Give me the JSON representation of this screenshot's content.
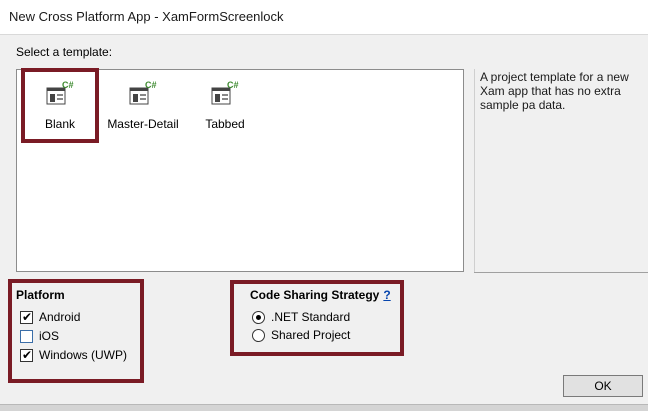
{
  "window": {
    "title": "New Cross Platform App - XamFormScreenlock"
  },
  "templates": {
    "heading": "Select a template:",
    "items": [
      {
        "label": "Blank",
        "badge": "C#",
        "selected": true
      },
      {
        "label": "Master-Detail",
        "badge": "C#",
        "selected": false
      },
      {
        "label": "Tabbed",
        "badge": "C#",
        "selected": false
      }
    ],
    "description": "A project template for a new Xam app that has no extra sample pa data."
  },
  "platform": {
    "title": "Platform",
    "options": [
      {
        "label": "Android",
        "checked": true
      },
      {
        "label": "iOS",
        "checked": false
      },
      {
        "label": "Windows (UWP)",
        "checked": true
      }
    ]
  },
  "code_sharing": {
    "title": "Code Sharing Strategy",
    "help": "?",
    "options": [
      {
        "label": ".NET Standard",
        "selected": true
      },
      {
        "label": "Shared Project",
        "selected": false
      }
    ]
  },
  "actions": {
    "ok": "OK"
  },
  "colors": {
    "highlight": "#7a1b25",
    "help_link": "#0645ad",
    "csharp_badge": "#3c8a2e"
  }
}
